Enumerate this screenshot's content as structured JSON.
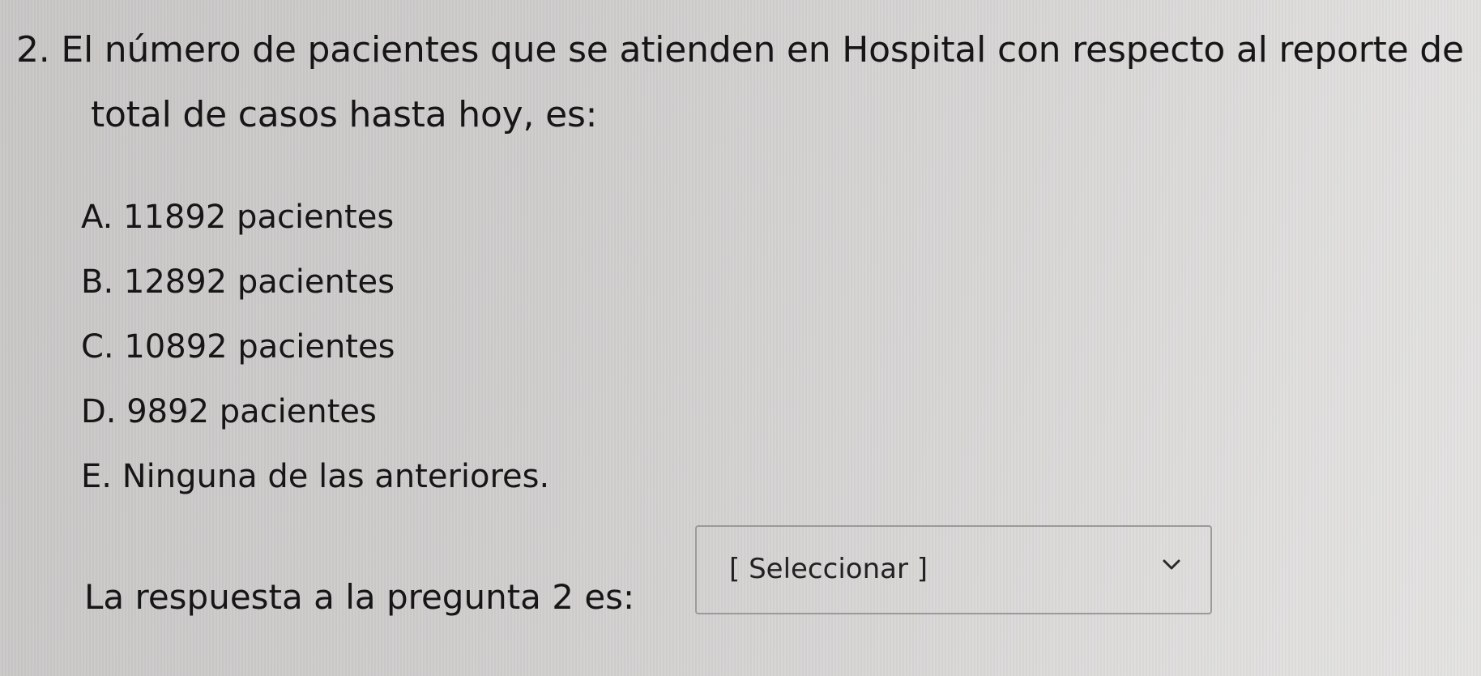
{
  "question": {
    "line1": "2. El número de pacientes que se atienden en Hospital con respecto al reporte de",
    "line2": "total de casos hasta hoy, es:"
  },
  "options": [
    {
      "label": "A. 11892 pacientes"
    },
    {
      "label": "B. 12892 pacientes"
    },
    {
      "label": "C. 10892 pacientes"
    },
    {
      "label": "D. 9892 pacientes"
    },
    {
      "label": "E. Ninguna de las anteriores."
    }
  ],
  "answer": {
    "label": "La respuesta a la pregunta 2 es:",
    "select_value": "[ Seleccionar ]",
    "icon": "chevron-down-icon"
  }
}
